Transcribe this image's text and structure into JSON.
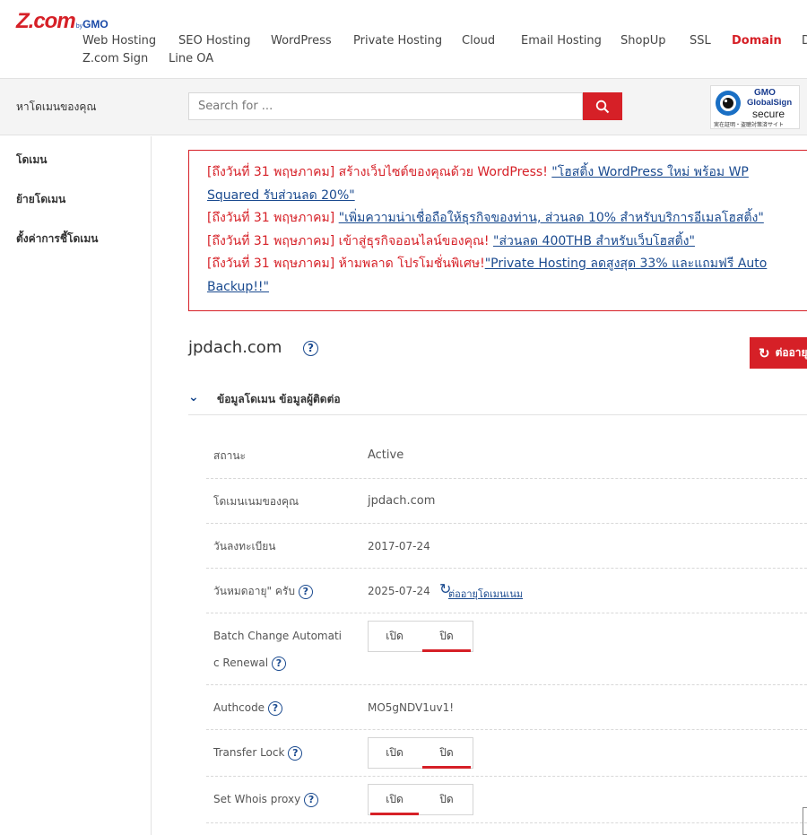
{
  "header": {
    "logo_main": "Z.com",
    "logo_by": "by",
    "logo_gmo": "GMO",
    "nav": [
      "Web Hosting",
      "SEO Hosting",
      "WordPress",
      "Private Hosting",
      "Cloud",
      "Email Hosting",
      "ShopUp",
      "SSL",
      "Domain",
      "D"
    ],
    "nav2": [
      "Z.com Sign",
      "Line OA"
    ],
    "active": "Domain"
  },
  "search": {
    "label": "หาโดเมนของคุณ",
    "placeholder": "Search for ...",
    "icon": "search-icon"
  },
  "badge": {
    "gmo": "GMO",
    "globalsign": "GlobalSign",
    "secure": "secure",
    "sub": "実在証明・盗聴対策済サイト"
  },
  "sidebar": {
    "items": [
      "โดเมน",
      "ย้ายโดเมน",
      "ตั้งค่าการชี้โดเมน"
    ]
  },
  "promo": {
    "lines": [
      {
        "prefix": "[ถึงวันที่ 31 พฤษภาคม] สร้างเว็บไซต์ของคุณด้วย WordPress! ",
        "link": "\"โฮสติ้ง WordPress ใหม่ พร้อม WP"
      },
      {
        "prefix": "",
        "link": "Squared รับส่วนลด 20%\""
      },
      {
        "prefix": "[ถึงวันที่ 31 พฤษภาคม] ",
        "link": "\"เพิ่มความน่าเชื่อถือให้ธุรกิจของท่าน, ส่วนลด 10% สำหรับบริการอีเมลโฮสติ้ง\""
      },
      {
        "prefix": "[ถึงวันที่ 31 พฤษภาคม] เข้าสู่ธุรกิจออนไลน์ของคุณ! ",
        "link": "\"ส่วนลด 400THB สำหรับเว็บโฮสติ้ง\""
      },
      {
        "prefix": "[ถึงวันที่ 31 พฤษภาคม] ห้ามพลาด โปรโมชั่นพิเศษ!",
        "link": "\"Private Hosting ลดสูงสุด 33% และแถมฟรี Auto"
      },
      {
        "prefix": "",
        "link": "Backup!!\""
      }
    ]
  },
  "domain": {
    "name": "jpdach.com",
    "help": "?",
    "renew_button": "ต่ออายุ",
    "section_title": "ข้อมูลโดเมน ข้อมูลผู้ติดต่อ"
  },
  "rows": {
    "status_label": "สถานะ",
    "status_value": "Active",
    "domain_label": "โดเมนเนมของคุณ",
    "domain_value": "jpdach.com",
    "reg_label": "วันลงทะเบียน",
    "reg_value": "2017-07-24",
    "exp_label": "วันหมดอายุ\" ครับ",
    "exp_value": "2025-07-24",
    "renew_link": "ต่ออายุโดเมนเนม",
    "batch_label_1": "Batch Change Automati",
    "batch_label_2": "c Renewal",
    "auth_label": "Authcode",
    "auth_value": "MO5gNDV1uv1!",
    "lock_label": "Transfer Lock",
    "whois_label": "Set Whois proxy",
    "on": "เปิด",
    "off": "ปิด"
  },
  "toggles": {
    "batch": "off",
    "transfer_lock": "off",
    "whois_proxy": "on"
  },
  "colors": {
    "brand_red": "#d62027",
    "link_blue": "#1a4a8f"
  }
}
